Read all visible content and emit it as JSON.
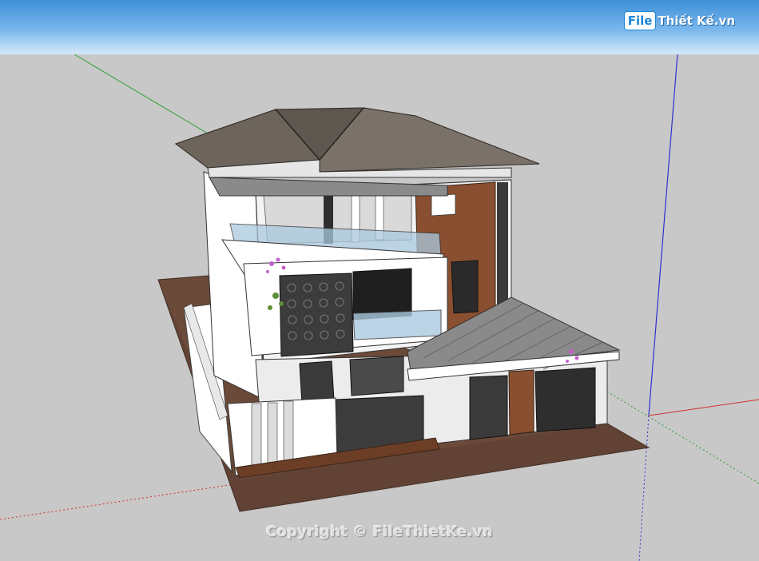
{
  "branding": {
    "logo_prefix": "File",
    "logo_rest": "Thiết Kế.vn"
  },
  "watermark": {
    "text": "Copyright © FileThietKe.vn"
  },
  "viewport": {
    "sky_color": "#5aa3e4",
    "ground_color": "#c8c8c8"
  },
  "axes": {
    "red_axis_color": "#d03030",
    "green_axis_color": "#30a030",
    "blue_axis_color": "#3030d0"
  },
  "colors": {
    "roof": "#6d655c",
    "roof_edge": "#3a342e",
    "wall": "#ffffff",
    "wood": "#8a4f30",
    "base": "#6b4a3a",
    "glass": "#aac9df",
    "screen": "#3c3c3c",
    "pergola": "#8a8a8a"
  },
  "icons": {
    "house_model": "3d-house-model",
    "axis_origin": "axis-origin-icon"
  }
}
